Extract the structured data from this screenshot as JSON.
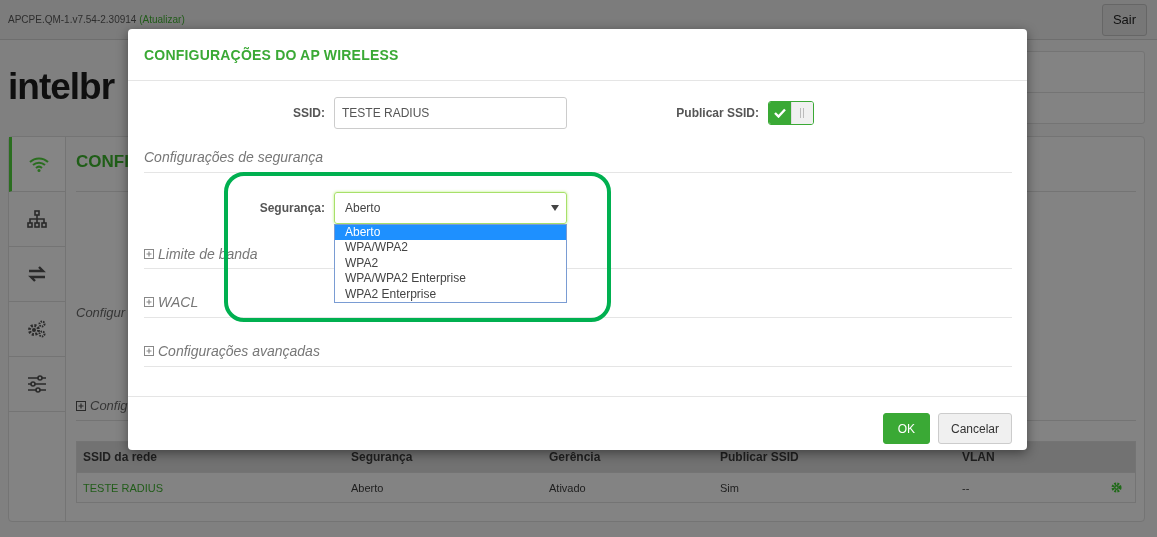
{
  "top_bar": {
    "version": "APCPE.QM-1.v7.54-2.30914",
    "update_link": "(Atualizar)",
    "logout_button": "Sair"
  },
  "logo": "intelbr",
  "sidebar": {
    "items": [
      {
        "kind": "wifi",
        "selected": true
      },
      {
        "kind": "network",
        "selected": false
      },
      {
        "kind": "transfer",
        "selected": false
      },
      {
        "kind": "gears",
        "selected": false
      },
      {
        "kind": "sliders",
        "selected": false
      }
    ]
  },
  "page": {
    "title": "CONFI",
    "section_heading": "Configur",
    "collapsible": {
      "label": "Config",
      "expanded": false
    }
  },
  "table": {
    "columns": [
      "SSID da rede",
      "Segurança",
      "Gerência",
      "Publicar SSID",
      "VLAN"
    ],
    "rows": [
      {
        "cells": [
          "TESTE RADIUS",
          "Aberto",
          "Ativado",
          "Sim",
          "--"
        ]
      }
    ]
  },
  "modal": {
    "title": "CONFIGURAÇÕES DO AP WIRELESS",
    "ssid": {
      "label": "SSID:",
      "value": "TESTE RADIUS"
    },
    "publish_ssid": {
      "label": "Publicar SSID:",
      "on": true
    },
    "security_heading": "Configurações de segurança",
    "security": {
      "label": "Segurança:",
      "value": "Aberto",
      "expanded": true,
      "options": [
        {
          "label": "Aberto",
          "selected": true
        },
        {
          "label": "WPA/WPA2",
          "selected": false
        },
        {
          "label": "WPA2",
          "selected": false
        },
        {
          "label": "WPA/WPA2 Enterprise",
          "selected": false
        },
        {
          "label": "WPA2 Enterprise",
          "selected": false
        }
      ]
    },
    "sections": [
      {
        "label": "Limite de banda",
        "expanded": false
      },
      {
        "label": "WACL",
        "expanded": false
      },
      {
        "label": "Configurações avançadas",
        "expanded": false
      }
    ],
    "buttons": [
      {
        "label": "OK",
        "kind": "primary"
      },
      {
        "label": "Cancelar",
        "kind": "default"
      }
    ]
  }
}
